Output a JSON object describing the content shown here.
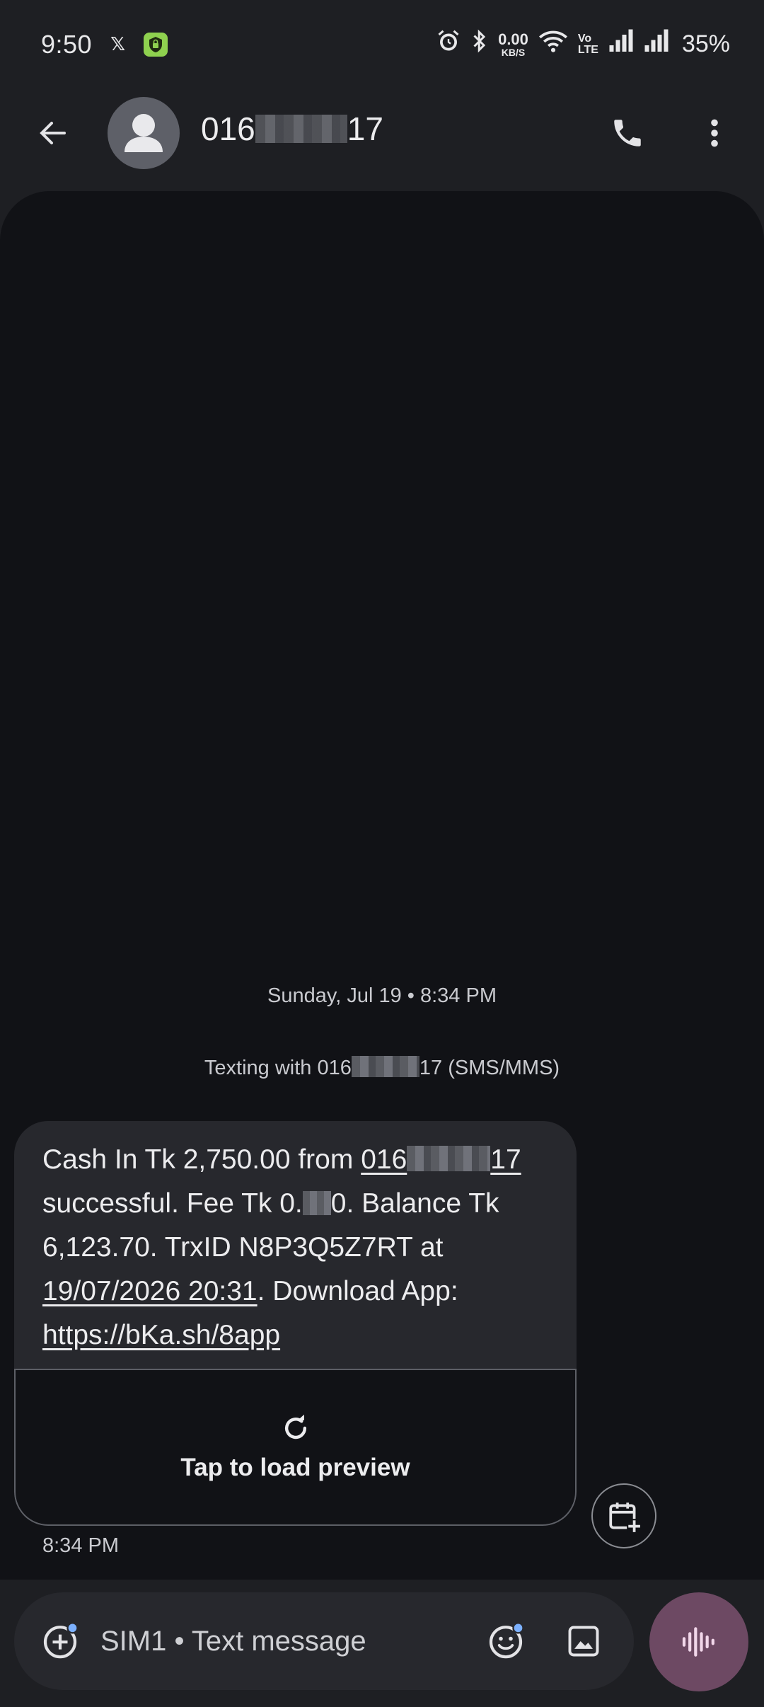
{
  "status_bar": {
    "time": "9:50",
    "x_label": "𝕏",
    "net_speed_value": "0.00",
    "net_speed_unit": "KB/S",
    "volte_top": "Vo",
    "volte_bottom": "LTE",
    "battery": "35%"
  },
  "header": {
    "contact_prefix": "016",
    "contact_suffix": "17"
  },
  "conversation": {
    "date_divider": "Sunday, Jul 19 • 8:34 PM",
    "texting_with_prefix": "Texting with 016",
    "texting_with_suffix": "17 (SMS/MMS)",
    "message": {
      "line1_text": "Cash In Tk 2,750.00 from ",
      "line1_link_prefix": "016",
      "line1_link_suffix": "17",
      "fee_prefix": " successful. Fee Tk 0.",
      "fee_suffix": "0. Balance Tk 6,123.70. TrxID N8P3Q5Z7RT at ",
      "date_link": "19/07/2026 20:31",
      "download_text": ". Download App: ",
      "url_link": "https://bKa.sh/8app",
      "preview_label": "Tap to load preview",
      "time": "8:34 PM"
    }
  },
  "compose": {
    "placeholder": "SIM1 • Text message"
  },
  "colors": {
    "background": "#1e1f23",
    "conversation_bg": "#111216",
    "bubble": "#27282d",
    "voice_button": "#6d4963",
    "badge_dot": "#7cb1ff"
  }
}
